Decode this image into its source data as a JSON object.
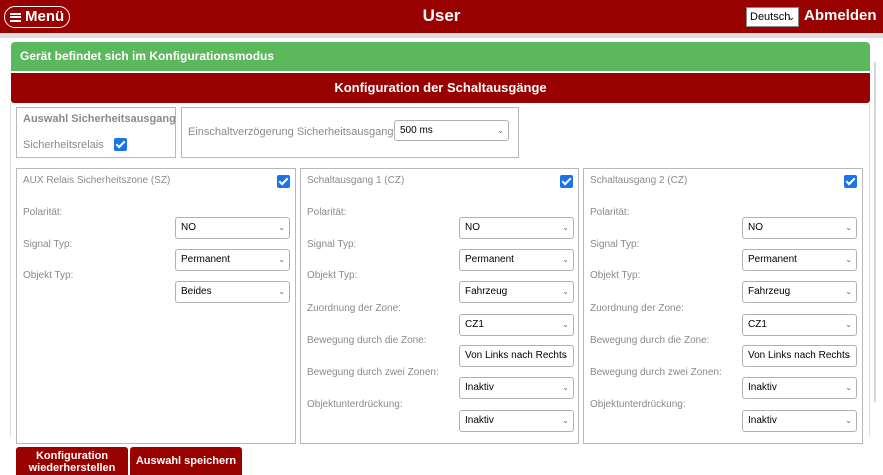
{
  "header": {
    "menu_label": "Menü",
    "title": "User",
    "language": "Deutsch",
    "logout_label": "Abmelden"
  },
  "status_message": "Gerät befindet sich im Konfigurationsmodus",
  "section_title": "Konfiguration der Schaltausgänge",
  "safety": {
    "heading": "Auswahl Sicherheitsausgang",
    "relay_label": "Sicherheitsrelais",
    "relay_checked": true,
    "delay_label": "Einschaltverzögerung Sicherheitsausgang:",
    "delay_value": "500 ms"
  },
  "outputs": [
    {
      "title": "AUX Relais Sicherheitszone (SZ)",
      "checked": true,
      "polarity_label": "Polarität:",
      "polarity": "NO",
      "signal_label": "Signal Typ:",
      "signal": "Permanent",
      "object_label": "Objekt Typ:",
      "object": "Beides"
    },
    {
      "title": "Schaltausgang 1 (CZ)",
      "checked": true,
      "polarity_label": "Polarität:",
      "polarity": "NO",
      "signal_label": "Signal Typ:",
      "signal": "Permanent",
      "object_label": "Objekt Typ:",
      "object": "Fahrzeug",
      "zone_label": "Zuordnung der Zone:",
      "zone": "CZ1",
      "movement_label": "Bewegung durch die Zone:",
      "movement": "Von Links nach Rechts",
      "two_zones_label": "Bewegung durch zwei Zonen:",
      "two_zones": "Inaktiv",
      "suppression_label": "Objektunterdrückung:",
      "suppression": "Inaktiv"
    },
    {
      "title": "Schaltausgang 2 (CZ)",
      "checked": true,
      "polarity_label": "Polarität:",
      "polarity": "NO",
      "signal_label": "Signal Typ:",
      "signal": "Permanent",
      "object_label": "Objekt Typ:",
      "object": "Fahrzeug",
      "zone_label": "Zuordnung der Zone:",
      "zone": "CZ1",
      "movement_label": "Bewegung durch die Zone:",
      "movement": "Von Links nach Rechts",
      "two_zones_label": "Bewegung durch zwei Zonen:",
      "two_zones": "Inaktiv",
      "suppression_label": "Objektunterdrückung:",
      "suppression": "Inaktiv"
    }
  ],
  "buttons": {
    "restore_line1": "Konfiguration",
    "restore_line2": "wiederherstellen",
    "save": "Auswahl speichern"
  },
  "colors": {
    "brand": "#990000",
    "success": "#5cb85c",
    "checkbox": "#1a73e8"
  },
  "icons": {
    "menu": "hamburger-icon",
    "dropdown": "chevron-down-icon",
    "checkbox": "checkmark-icon"
  }
}
